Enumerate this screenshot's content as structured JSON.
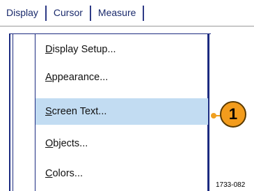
{
  "menubar": {
    "items": [
      "Display",
      "Cursor",
      "Measure"
    ]
  },
  "dropdown": {
    "items": [
      {
        "pre": "",
        "u": "D",
        "post": "isplay Setup..."
      },
      {
        "pre": "",
        "u": "A",
        "post": "ppearance..."
      },
      {
        "pre": "",
        "u": "S",
        "post": "creen Text..."
      },
      {
        "pre": "",
        "u": "O",
        "post": "bjects..."
      },
      {
        "pre": "",
        "u": "C",
        "post": "olors..."
      }
    ],
    "selected_index": 2
  },
  "callout": {
    "number": "1"
  },
  "figure_code": "1733-082",
  "colors": {
    "menu_text": "#1a2a6c",
    "frame": "#1c2b80",
    "selection": "#c2dcf2",
    "callout": "#f39c1c"
  }
}
